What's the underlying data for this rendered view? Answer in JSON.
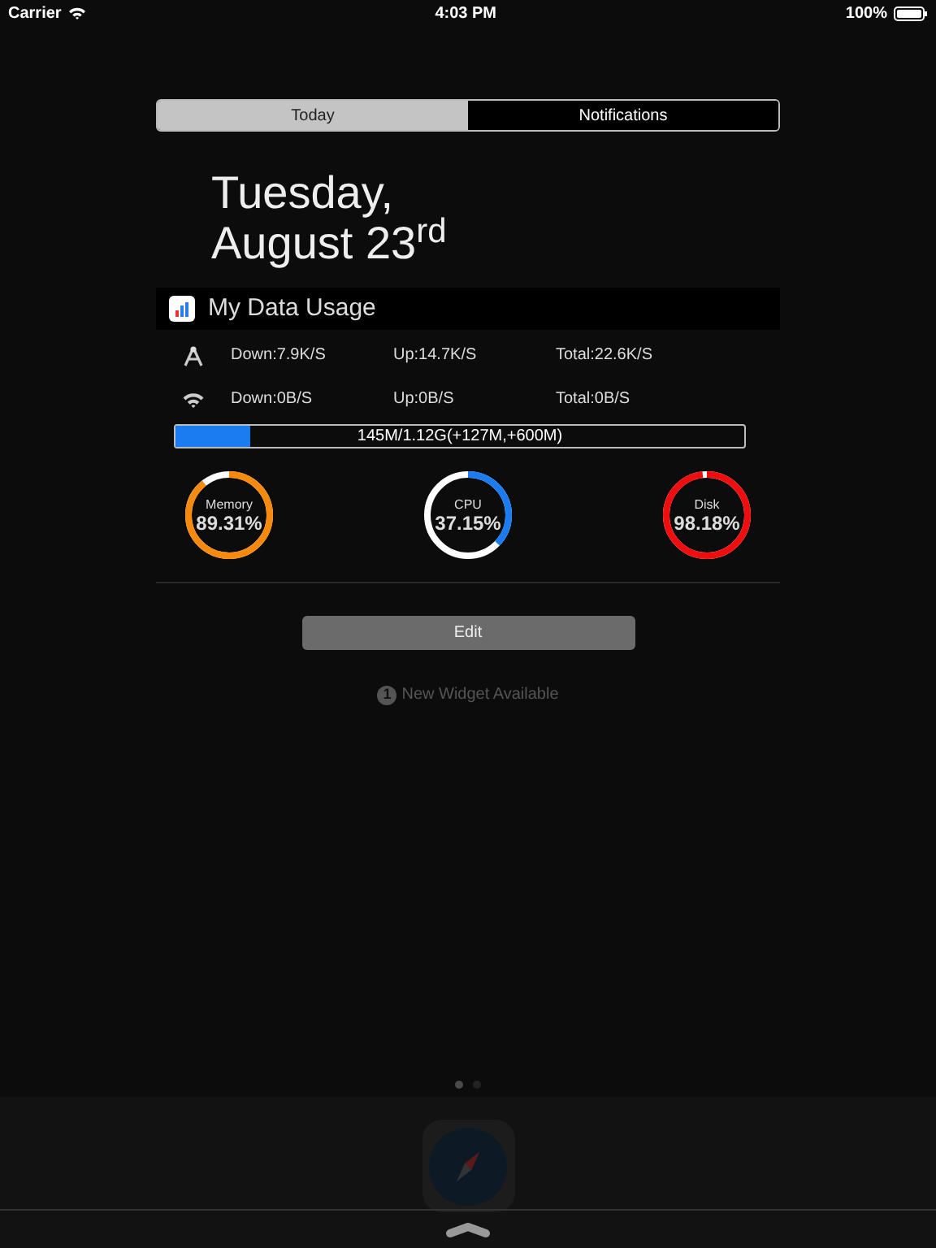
{
  "status_bar": {
    "carrier": "Carrier",
    "time": "4:03 PM",
    "battery": "100%"
  },
  "tabs": [
    {
      "label": "Today",
      "selected": true
    },
    {
      "label": "Notifications",
      "selected": false
    }
  ],
  "date": {
    "line_1": "Tuesday,",
    "line_2": "August 23$^{rd}$"
  },
  "widget": {
    "title": "My Data Usage",
    "network": [
      {
        "kind": "cellular",
        "down": "Down:7.9K/S",
        "up": "Up:14.7K/S",
        "total": "Total:22.6K/S"
      },
      {
        "kind": "wifi",
        "down": "Down:0B/S",
        "up": "Up:0B/S",
        "total": "Total:0B/S"
      }
    ],
    "usage": {
      "level": 0.13,
      "text": "145M/1.12G(+127M,+600M)"
    },
    "gauges": [
      {
        "label": "Memory",
        "value": "89.31%",
        "level": 0.8931,
        "color": "#f7890c"
      },
      {
        "label": "CPU",
        "value": "37.15%",
        "level": 0.3715,
        "color": "#1a7cf0"
      },
      {
        "label": "Disk",
        "value": "98.18%",
        "level": 0.9818,
        "color": "#f00d0d"
      }
    ]
  },
  "edit_button": "Edit",
  "new_widget": {
    "count": "1",
    "text": "New Widget Available"
  },
  "page_dots": [
    {
      "selected": true
    },
    {
      "selected": false
    }
  ]
}
